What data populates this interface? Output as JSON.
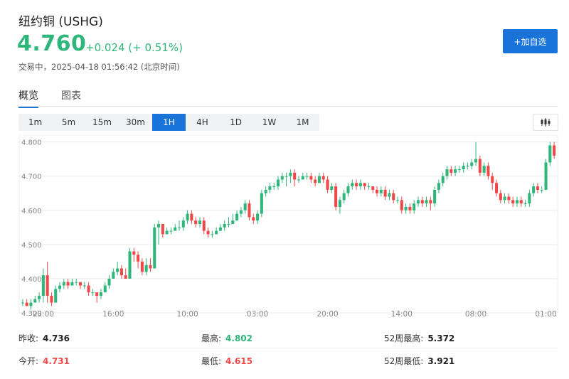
{
  "header": {
    "title": "纽约铜 (USHG)",
    "price": "4.760",
    "change": "+0.024 (+ 0.51%)",
    "status": "交易中，2025-04-18 01:56:42 (北京时间)",
    "add_button": "+加自选"
  },
  "tabs": [
    {
      "label": "概览",
      "active": true
    },
    {
      "label": "图表",
      "active": false
    }
  ],
  "ranges": [
    {
      "label": "1m",
      "active": false
    },
    {
      "label": "5m",
      "active": false
    },
    {
      "label": "15m",
      "active": false
    },
    {
      "label": "30m",
      "active": false
    },
    {
      "label": "1H",
      "active": true
    },
    {
      "label": "4H",
      "active": false
    },
    {
      "label": "1D",
      "active": false
    },
    {
      "label": "1W",
      "active": false
    },
    {
      "label": "1M",
      "active": false
    }
  ],
  "stats": {
    "prev_close_label": "昨收:",
    "prev_close": "4.736",
    "open_label": "今开:",
    "open": "4.731",
    "high_label": "最高:",
    "high": "4.802",
    "low_label": "最低:",
    "low": "4.615",
    "high52_label": "52周最高:",
    "high52": "5.372",
    "low52_label": "52周最低:",
    "low52": "3.921"
  },
  "colors": {
    "up": "#2fb67a",
    "down": "#f04848",
    "accent": "#1a73d9"
  },
  "chart_data": {
    "type": "candlestick",
    "title": "",
    "ylim": [
      4.3,
      4.82
    ],
    "yticks": [
      4.8,
      4.7,
      4.6,
      4.5,
      4.4,
      4.3
    ],
    "ytick_labels": [
      "4.800",
      "4.700",
      "4.600",
      "4.500",
      "4.400",
      "4.300"
    ],
    "xtick_labels": [
      {
        "label": "23:00",
        "index": 5
      },
      {
        "label": "16:00",
        "index": 22
      },
      {
        "label": "10:00",
        "index": 40
      },
      {
        "label": "03:00",
        "index": 57
      },
      {
        "label": "20:00",
        "index": 74
      },
      {
        "label": "14:00",
        "index": 92
      },
      {
        "label": "08:00",
        "index": 110
      },
      {
        "label": "01:00",
        "index": 127
      }
    ],
    "grid": true,
    "candles": [
      [
        4.33,
        4.33,
        4.32,
        4.34
      ],
      [
        4.33,
        4.32,
        4.32,
        4.34
      ],
      [
        4.32,
        4.33,
        4.31,
        4.34
      ],
      [
        4.33,
        4.34,
        4.33,
        4.35
      ],
      [
        4.34,
        4.35,
        4.33,
        4.36
      ],
      [
        4.35,
        4.41,
        4.33,
        4.43
      ],
      [
        4.41,
        4.35,
        4.33,
        4.45
      ],
      [
        4.35,
        4.33,
        4.32,
        4.36
      ],
      [
        4.33,
        4.37,
        4.33,
        4.38
      ],
      [
        4.37,
        4.38,
        4.36,
        4.39
      ],
      [
        4.38,
        4.39,
        4.37,
        4.4
      ],
      [
        4.39,
        4.38,
        4.37,
        4.4
      ],
      [
        4.38,
        4.39,
        4.38,
        4.4
      ],
      [
        4.39,
        4.39,
        4.38,
        4.4
      ],
      [
        4.39,
        4.38,
        4.37,
        4.39
      ],
      [
        4.38,
        4.38,
        4.37,
        4.39
      ],
      [
        4.38,
        4.36,
        4.35,
        4.39
      ],
      [
        4.36,
        4.36,
        4.35,
        4.37
      ],
      [
        4.36,
        4.35,
        4.33,
        4.36
      ],
      [
        4.35,
        4.36,
        4.34,
        4.37
      ],
      [
        4.36,
        4.38,
        4.36,
        4.39
      ],
      [
        4.38,
        4.4,
        4.37,
        4.41
      ],
      [
        4.4,
        4.42,
        4.4,
        4.43
      ],
      [
        4.42,
        4.43,
        4.41,
        4.45
      ],
      [
        4.43,
        4.41,
        4.4,
        4.44
      ],
      [
        4.41,
        4.4,
        4.4,
        4.43
      ],
      [
        4.4,
        4.48,
        4.4,
        4.49
      ],
      [
        4.48,
        4.47,
        4.45,
        4.49
      ],
      [
        4.47,
        4.45,
        4.43,
        4.48
      ],
      [
        4.45,
        4.42,
        4.41,
        4.46
      ],
      [
        4.42,
        4.44,
        4.41,
        4.46
      ],
      [
        4.44,
        4.43,
        4.42,
        4.46
      ],
      [
        4.43,
        4.55,
        4.43,
        4.56
      ],
      [
        4.55,
        4.56,
        4.5,
        4.57
      ],
      [
        4.56,
        4.53,
        4.52,
        4.56
      ],
      [
        4.53,
        4.54,
        4.53,
        4.55
      ],
      [
        4.54,
        4.54,
        4.53,
        4.55
      ],
      [
        4.54,
        4.55,
        4.54,
        4.56
      ],
      [
        4.55,
        4.55,
        4.54,
        4.57
      ],
      [
        4.55,
        4.57,
        4.54,
        4.58
      ],
      [
        4.57,
        4.59,
        4.56,
        4.6
      ],
      [
        4.59,
        4.57,
        4.56,
        4.6
      ],
      [
        4.57,
        4.56,
        4.55,
        4.58
      ],
      [
        4.56,
        4.57,
        4.55,
        4.58
      ],
      [
        4.57,
        4.54,
        4.53,
        4.58
      ],
      [
        4.54,
        4.53,
        4.52,
        4.55
      ],
      [
        4.53,
        4.53,
        4.52,
        4.54
      ],
      [
        4.53,
        4.54,
        4.53,
        4.55
      ],
      [
        4.54,
        4.55,
        4.54,
        4.56
      ],
      [
        4.55,
        4.56,
        4.54,
        4.57
      ],
      [
        4.56,
        4.56,
        4.55,
        4.58
      ],
      [
        4.56,
        4.57,
        4.56,
        4.59
      ],
      [
        4.57,
        4.59,
        4.57,
        4.6
      ],
      [
        4.59,
        4.6,
        4.58,
        4.61
      ],
      [
        4.6,
        4.62,
        4.59,
        4.63
      ],
      [
        4.62,
        4.58,
        4.57,
        4.63
      ],
      [
        4.58,
        4.57,
        4.56,
        4.59
      ],
      [
        4.57,
        4.59,
        4.56,
        4.6
      ],
      [
        4.59,
        4.65,
        4.58,
        4.66
      ],
      [
        4.65,
        4.66,
        4.64,
        4.67
      ],
      [
        4.66,
        4.67,
        4.65,
        4.68
      ],
      [
        4.67,
        4.67,
        4.66,
        4.68
      ],
      [
        4.67,
        4.69,
        4.66,
        4.7
      ],
      [
        4.69,
        4.7,
        4.68,
        4.71
      ],
      [
        4.7,
        4.7,
        4.67,
        4.71
      ],
      [
        4.7,
        4.71,
        4.68,
        4.72
      ],
      [
        4.71,
        4.69,
        4.67,
        4.72
      ],
      [
        4.69,
        4.69,
        4.68,
        4.7
      ],
      [
        4.69,
        4.7,
        4.69,
        4.71
      ],
      [
        4.7,
        4.7,
        4.69,
        4.71
      ],
      [
        4.7,
        4.69,
        4.68,
        4.71
      ],
      [
        4.69,
        4.68,
        4.67,
        4.7
      ],
      [
        4.68,
        4.7,
        4.68,
        4.71
      ],
      [
        4.7,
        4.69,
        4.68,
        4.71
      ],
      [
        4.69,
        4.66,
        4.65,
        4.7
      ],
      [
        4.66,
        4.67,
        4.65,
        4.68
      ],
      [
        4.67,
        4.61,
        4.6,
        4.68
      ],
      [
        4.61,
        4.63,
        4.59,
        4.64
      ],
      [
        4.63,
        4.65,
        4.62,
        4.66
      ],
      [
        4.65,
        4.67,
        4.64,
        4.68
      ],
      [
        4.67,
        4.68,
        4.66,
        4.69
      ],
      [
        4.68,
        4.67,
        4.66,
        4.69
      ],
      [
        4.67,
        4.68,
        4.66,
        4.69
      ],
      [
        4.68,
        4.67,
        4.66,
        4.68
      ],
      [
        4.67,
        4.67,
        4.66,
        4.68
      ],
      [
        4.67,
        4.66,
        4.65,
        4.67
      ],
      [
        4.66,
        4.65,
        4.64,
        4.67
      ],
      [
        4.65,
        4.66,
        4.64,
        4.67
      ],
      [
        4.66,
        4.64,
        4.63,
        4.67
      ],
      [
        4.64,
        4.65,
        4.63,
        4.66
      ],
      [
        4.65,
        4.63,
        4.62,
        4.66
      ],
      [
        4.63,
        4.63,
        4.62,
        4.64
      ],
      [
        4.63,
        4.6,
        4.59,
        4.64
      ],
      [
        4.6,
        4.61,
        4.59,
        4.62
      ],
      [
        4.61,
        4.6,
        4.59,
        4.62
      ],
      [
        4.6,
        4.62,
        4.59,
        4.63
      ],
      [
        4.62,
        4.63,
        4.61,
        4.64
      ],
      [
        4.63,
        4.62,
        4.61,
        4.64
      ],
      [
        4.62,
        4.63,
        4.61,
        4.64
      ],
      [
        4.63,
        4.62,
        4.6,
        4.64
      ],
      [
        4.62,
        4.66,
        4.61,
        4.67
      ],
      [
        4.66,
        4.68,
        4.65,
        4.69
      ],
      [
        4.68,
        4.7,
        4.67,
        4.71
      ],
      [
        4.7,
        4.72,
        4.69,
        4.73
      ],
      [
        4.72,
        4.71,
        4.7,
        4.73
      ],
      [
        4.71,
        4.72,
        4.7,
        4.73
      ],
      [
        4.72,
        4.72,
        4.71,
        4.73
      ],
      [
        4.72,
        4.73,
        4.71,
        4.74
      ],
      [
        4.73,
        4.73,
        4.72,
        4.74
      ],
      [
        4.73,
        4.74,
        4.72,
        4.75
      ],
      [
        4.74,
        4.75,
        4.73,
        4.8
      ],
      [
        4.75,
        4.71,
        4.7,
        4.76
      ],
      [
        4.71,
        4.73,
        4.7,
        4.74
      ],
      [
        4.73,
        4.7,
        4.69,
        4.74
      ],
      [
        4.7,
        4.68,
        4.66,
        4.71
      ],
      [
        4.68,
        4.65,
        4.64,
        4.69
      ],
      [
        4.65,
        4.63,
        4.62,
        4.66
      ],
      [
        4.63,
        4.64,
        4.62,
        4.65
      ],
      [
        4.64,
        4.63,
        4.62,
        4.65
      ],
      [
        4.63,
        4.62,
        4.61,
        4.64
      ],
      [
        4.62,
        4.63,
        4.61,
        4.64
      ],
      [
        4.63,
        4.62,
        4.61,
        4.64
      ],
      [
        4.62,
        4.62,
        4.61,
        4.63
      ],
      [
        4.62,
        4.65,
        4.61,
        4.66
      ],
      [
        4.65,
        4.67,
        4.64,
        4.68
      ],
      [
        4.67,
        4.66,
        4.65,
        4.68
      ],
      [
        4.66,
        4.66,
        4.65,
        4.67
      ],
      [
        4.66,
        4.74,
        4.66,
        4.75
      ],
      [
        4.74,
        4.79,
        4.73,
        4.8
      ],
      [
        4.79,
        4.76,
        4.75,
        4.8
      ]
    ]
  }
}
